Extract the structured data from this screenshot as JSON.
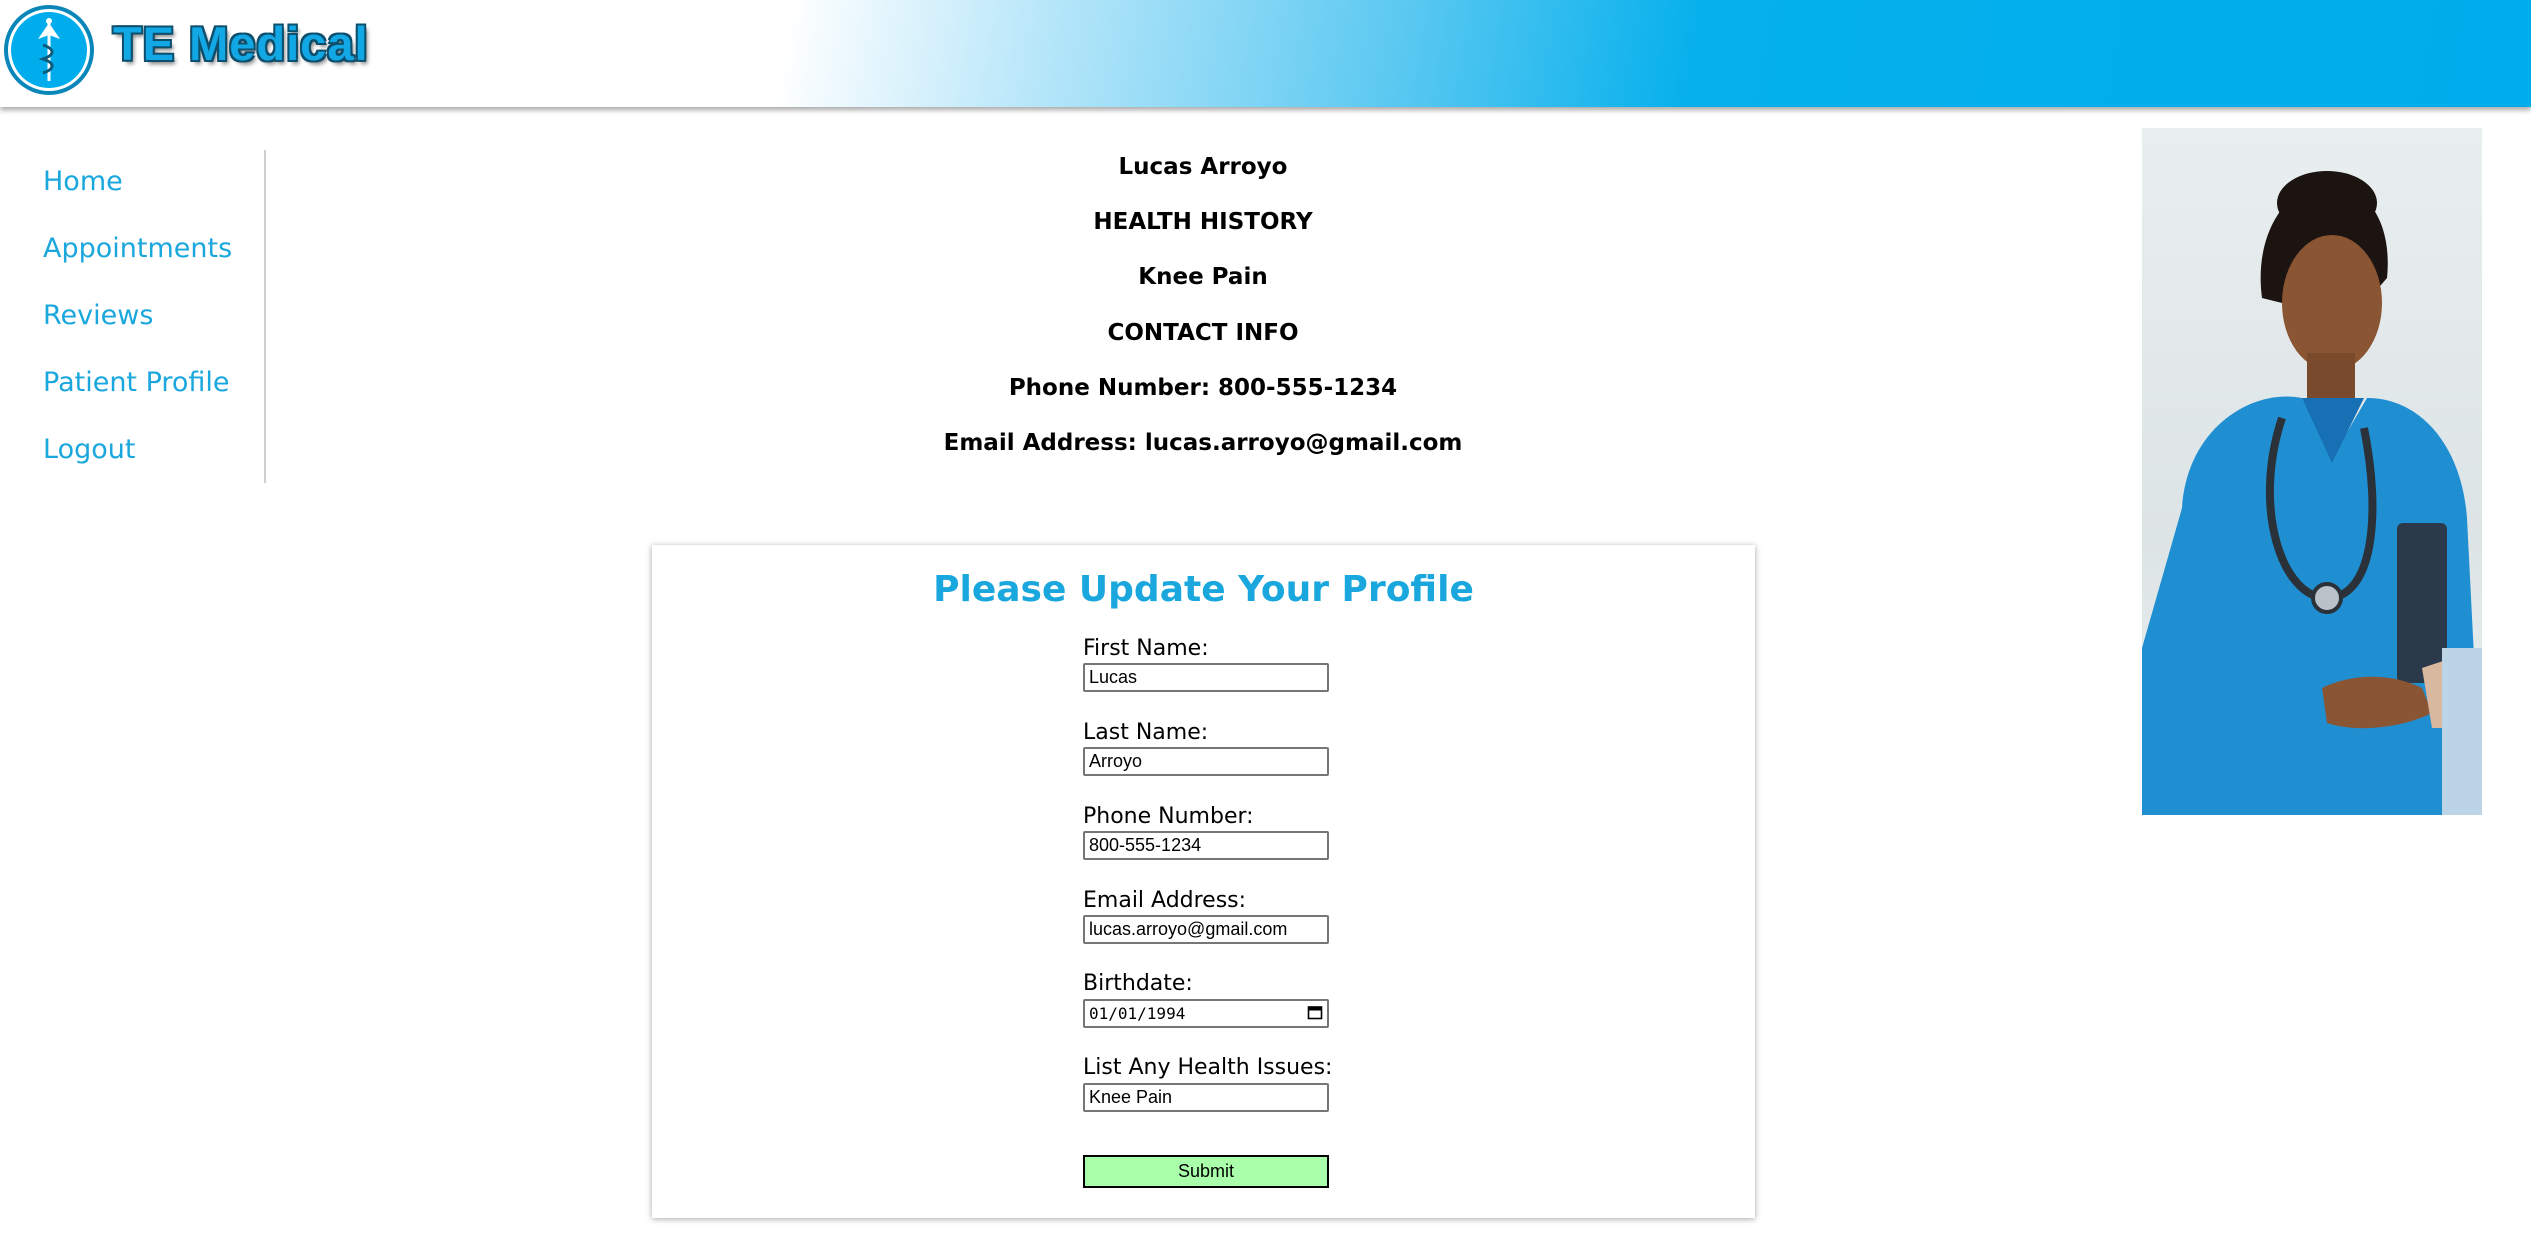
{
  "header": {
    "brand": "TE Medical"
  },
  "sidebar": {
    "items": [
      {
        "label": "Home"
      },
      {
        "label": "Appointments"
      },
      {
        "label": "Reviews"
      },
      {
        "label": "Patient Profile"
      },
      {
        "label": "Logout"
      }
    ]
  },
  "profile": {
    "name": "Lucas Arroyo",
    "health_history_heading": "HEALTH HISTORY",
    "health_issue": "Knee Pain",
    "contact_heading": "CONTACT INFO",
    "phone_line": "Phone Number: 800-555-1234",
    "email_line": "Email Address: lucas.arroyo@gmail.com"
  },
  "form": {
    "title": "Please Update Your Profile",
    "fields": [
      {
        "label": "First Name:",
        "value": "Lucas"
      },
      {
        "label": "Last Name:",
        "value": "Arroyo"
      },
      {
        "label": "Phone Number:",
        "value": "800-555-1234"
      },
      {
        "label": "Email Address:",
        "value": "lucas.arroyo@gmail.com"
      },
      {
        "label": "Birthdate:",
        "value": "01/01/1994"
      },
      {
        "label": "List Any Health Issues:",
        "value": "Knee Pain"
      }
    ],
    "submit_label": "Submit"
  },
  "colors": {
    "brand_blue": "#00adec",
    "link_blue": "#1aa7dd",
    "submit_green": "#aaffaa"
  }
}
